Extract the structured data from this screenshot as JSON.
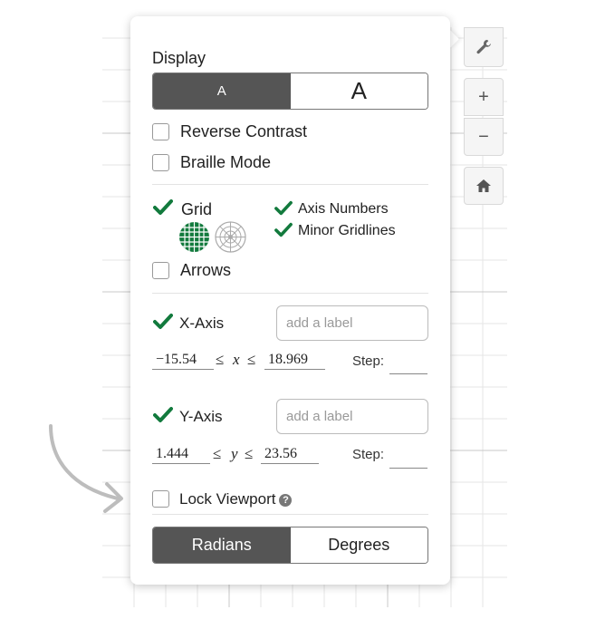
{
  "display": {
    "heading": "Display",
    "font_small": "A",
    "font_large": "A"
  },
  "options": {
    "reverse_contrast": "Reverse Contrast",
    "braille_mode": "Braille Mode"
  },
  "grid": {
    "label": "Grid",
    "axis_numbers": "Axis Numbers",
    "minor_gridlines": "Minor Gridlines",
    "arrows": "Arrows"
  },
  "x_axis": {
    "label": "X-Axis",
    "placeholder": "add a label",
    "min": "−15.54",
    "max": "18.969",
    "leq": "≤",
    "var": "x",
    "step_label": "Step:"
  },
  "y_axis": {
    "label": "Y-Axis",
    "placeholder": "add a label",
    "min": "1.444",
    "max": "23.56",
    "leq": "≤",
    "var": "y",
    "step_label": "Step:"
  },
  "lock_viewport": {
    "label": "Lock Viewport",
    "help": "?"
  },
  "angle": {
    "radians": "Radians",
    "degrees": "Degrees"
  },
  "tools": {
    "plus": "+",
    "minus": "−"
  },
  "colors": {
    "accent_green": "#127a3d",
    "selected_segment": "#555555"
  }
}
